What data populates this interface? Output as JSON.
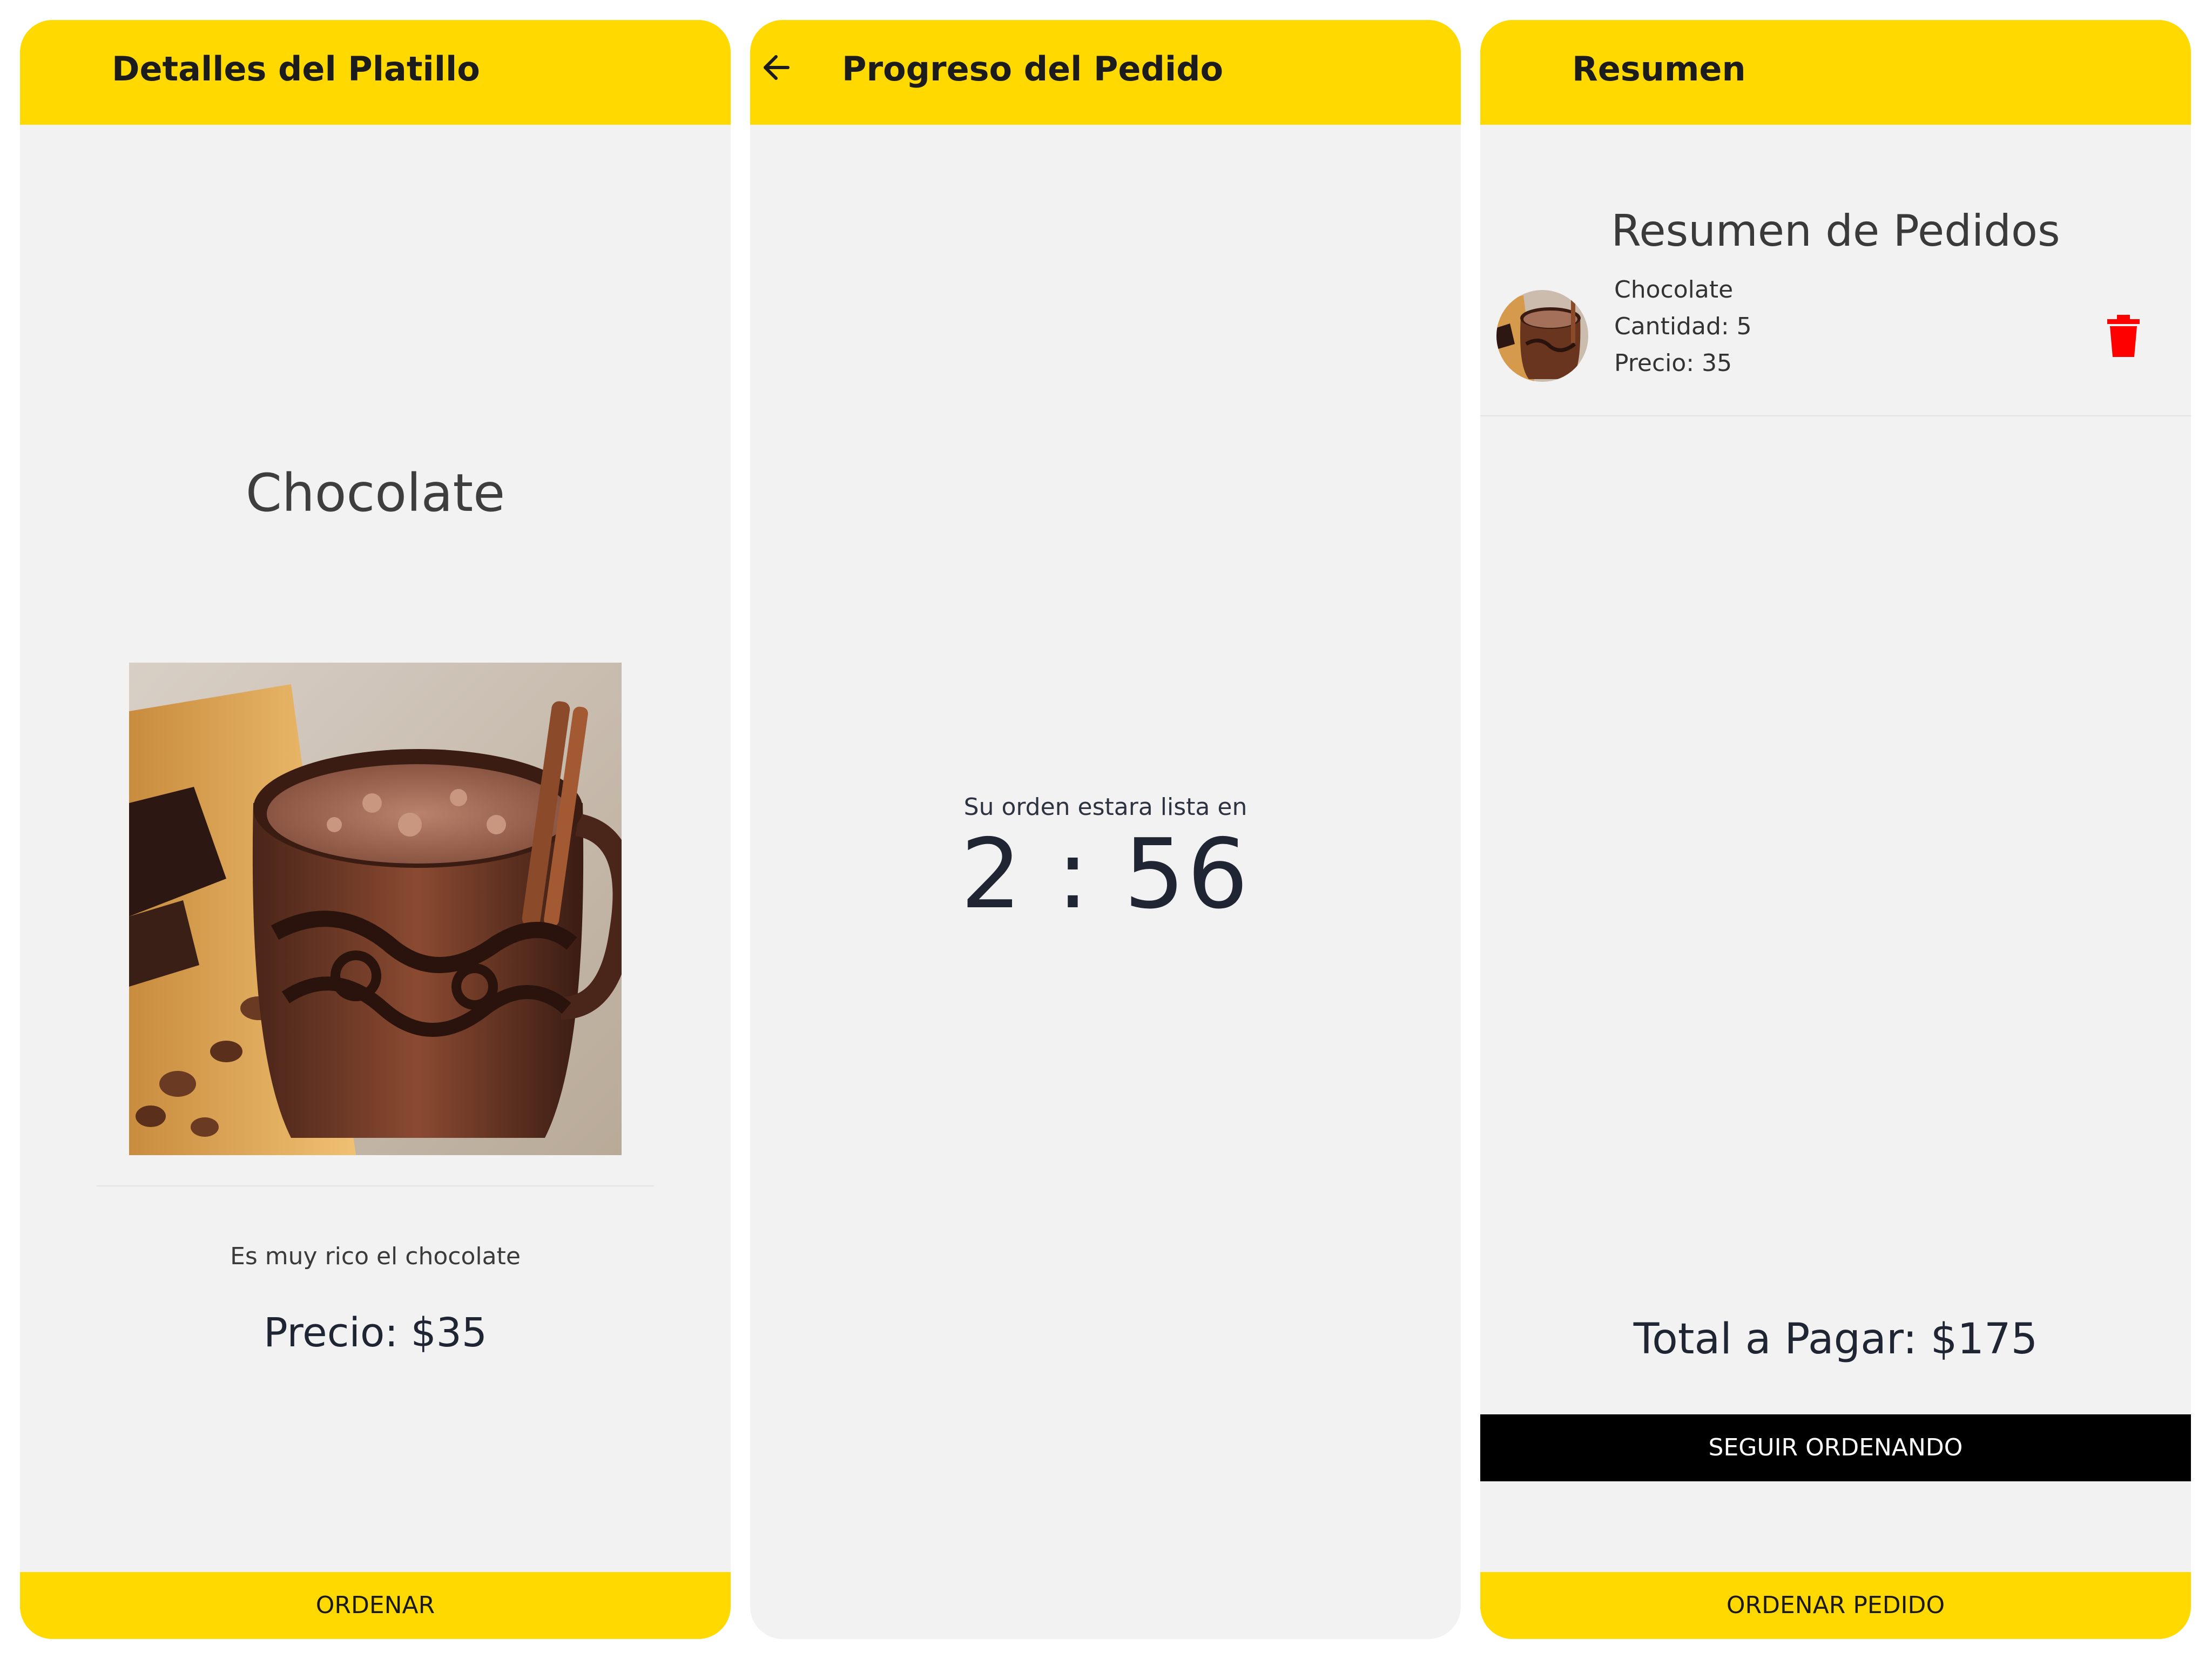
{
  "colors": {
    "accent": "#ffd900",
    "background": "#f2f2f2",
    "dark_button": "#000000",
    "delete": "#ff0000"
  },
  "details": {
    "title": "Detalles del Platillo",
    "dish_name": "Chocolate",
    "image_icon": "hot-chocolate-photo",
    "description": "Es muy rico el chocolate",
    "price": "Precio: $35",
    "order_button": "ORDENAR"
  },
  "progress": {
    "title": "Progreso del Pedido",
    "back_icon": "arrow-left-icon",
    "ready_label": "Su orden estara lista en",
    "countdown": "2 : 56"
  },
  "summary": {
    "title": "Resumen",
    "heading": "Resumen de Pedidos",
    "items": [
      {
        "name": "Chocolate",
        "quantity": "Cantidad: 5",
        "price": "Precio: 35"
      }
    ],
    "delete_icon": "trash-icon",
    "total": "Total a Pagar: $175",
    "continue_button": "SEGUIR ORDENANDO",
    "order_button": "ORDENAR PEDIDO"
  }
}
